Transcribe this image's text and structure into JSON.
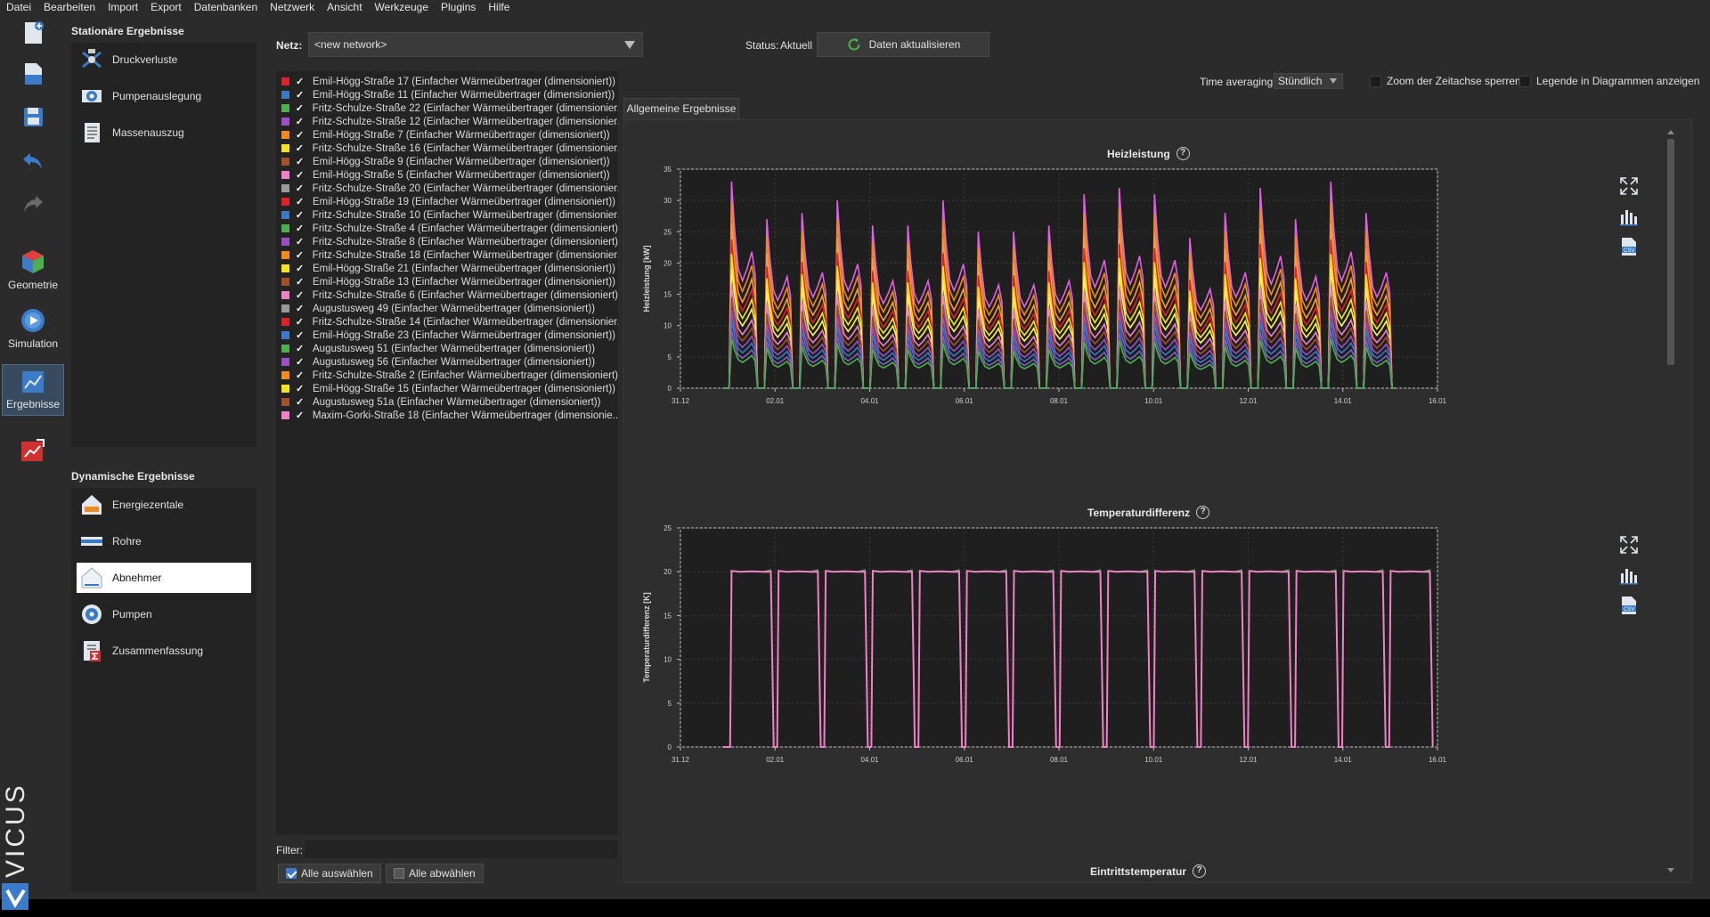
{
  "menu": [
    "Datei",
    "Bearbeiten",
    "Import",
    "Export",
    "Datenbanken",
    "Netzwerk",
    "Ansicht",
    "Werkzeuge",
    "Plugins",
    "Hilfe"
  ],
  "toolbar": {
    "geometry_label": "Geometrie",
    "simulation_label": "Simulation",
    "results_label": "Ergebnisse",
    "brand": "VICUS"
  },
  "stationary": {
    "title": "Stationäre Ergebnisse",
    "items": [
      "Druckverluste",
      "Pumpenauslegung",
      "Massenauszug"
    ]
  },
  "dynamic": {
    "title": "Dynamische Ergebnisse",
    "items": [
      "Energiezentale",
      "Rohre",
      "Abnehmer",
      "Pumpen",
      "Zusammenfassung"
    ],
    "selected": "Abnehmer"
  },
  "network": {
    "label": "Netz:",
    "value": "<new network>",
    "status_label": "Status:",
    "status_value": "Aktuell",
    "refresh_label": "Daten aktualisieren"
  },
  "consumers": [
    {
      "name": "Emil-Högg-Straße 17 (Einfacher Wärmeübertrager (dimensioniert))",
      "color": "#e0202a"
    },
    {
      "name": "Emil-Högg-Straße 11 (Einfacher Wärmeübertrager (dimensioniert))",
      "color": "#3c78c8"
    },
    {
      "name": "Fritz-Schulze-Straße 22 (Einfacher Wärmeübertrager (dimensionier...",
      "color": "#4caf50"
    },
    {
      "name": "Fritz-Schulze-Straße 12 (Einfacher Wärmeübertrager (dimensionier...",
      "color": "#9c4fc4"
    },
    {
      "name": "Emil-Högg-Straße 7 (Einfacher Wärmeübertrager (dimensioniert))",
      "color": "#f08a1c"
    },
    {
      "name": "Fritz-Schulze-Straße 16 (Einfacher Wärmeübertrager (dimensionier...",
      "color": "#f2e520"
    },
    {
      "name": "Emil-Högg-Straße 9 (Einfacher Wärmeübertrager (dimensioniert))",
      "color": "#a0522d"
    },
    {
      "name": "Emil-Högg-Straße 5 (Einfacher Wärmeübertrager (dimensioniert))",
      "color": "#f080c8"
    },
    {
      "name": "Fritz-Schulze-Straße 20 (Einfacher Wärmeübertrager (dimensionier...",
      "color": "#9a9a9a"
    },
    {
      "name": "Emil-Högg-Straße 19 (Einfacher Wärmeübertrager (dimensioniert))",
      "color": "#e0202a"
    },
    {
      "name": "Fritz-Schulze-Straße 10 (Einfacher Wärmeübertrager (dimensionier...",
      "color": "#3c78c8"
    },
    {
      "name": "Fritz-Schulze-Straße 4 (Einfacher Wärmeübertrager (dimensioniert))",
      "color": "#4caf50"
    },
    {
      "name": "Fritz-Schulze-Straße 8 (Einfacher Wärmeübertrager (dimensioniert))",
      "color": "#9c4fc4"
    },
    {
      "name": "Fritz-Schulze-Straße 18 (Einfacher Wärmeübertrager (dimensionier...",
      "color": "#f08a1c"
    },
    {
      "name": "Emil-Högg-Straße 21 (Einfacher Wärmeübertrager (dimensioniert))",
      "color": "#f2e520"
    },
    {
      "name": "Emil-Högg-Straße 13 (Einfacher Wärmeübertrager (dimensioniert))",
      "color": "#a0522d"
    },
    {
      "name": "Fritz-Schulze-Straße 6 (Einfacher Wärmeübertrager (dimensioniert))",
      "color": "#f080c8"
    },
    {
      "name": "Augustusweg 49 (Einfacher Wärmeübertrager (dimensioniert))",
      "color": "#9a9a9a"
    },
    {
      "name": "Fritz-Schulze-Straße 14 (Einfacher Wärmeübertrager (dimensionier...",
      "color": "#e0202a"
    },
    {
      "name": "Emil-Högg-Straße 23 (Einfacher Wärmeübertrager (dimensioniert))",
      "color": "#3c78c8"
    },
    {
      "name": "Augustusweg 51 (Einfacher Wärmeübertrager (dimensioniert))",
      "color": "#4caf50"
    },
    {
      "name": "Augustusweg 56 (Einfacher Wärmeübertrager (dimensioniert))",
      "color": "#9c4fc4"
    },
    {
      "name": "Fritz-Schulze-Straße 2 (Einfacher Wärmeübertrager (dimensioniert))",
      "color": "#f08a1c"
    },
    {
      "name": "Emil-Högg-Straße 15 (Einfacher Wärmeübertrager (dimensioniert))",
      "color": "#f2e520"
    },
    {
      "name": "Augustusweg 51a (Einfacher Wärmeübertrager (dimensioniert))",
      "color": "#a0522d"
    },
    {
      "name": "Maxim-Gorki-Straße 18 (Einfacher Wärmeübertrager (dimensionie...",
      "color": "#f080c8"
    }
  ],
  "filter": {
    "label": "Filter:",
    "value": ""
  },
  "select_all_label": "Alle auswählen",
  "deselect_all_label": "Alle abwählen",
  "options": {
    "time_averaging_label": "Time averaging",
    "time_averaging_value": "Stündlich",
    "zoom_lock_label": "Zoom der Zeitachse sperren",
    "legend_label": "Legende in Diagrammen anzeigen"
  },
  "tab_label": "Allgemeine Ergebnisse",
  "third_chart_title": "Eintrittstemperatur",
  "chart_data": [
    {
      "type": "line",
      "title": "Heizleistung",
      "ylabel": "Heizleistung [kW]",
      "ylim": [
        0,
        35
      ],
      "yticks": [
        "0",
        "5",
        "10",
        "15",
        "20",
        "25",
        "30",
        "35"
      ],
      "xticks": [
        "31.12",
        "02.01",
        "04.01",
        "06.01",
        "08.01",
        "10.01",
        "12.01",
        "14.01",
        "16.01"
      ],
      "grid": true,
      "day_peaks_kW": [
        33,
        27,
        28,
        30,
        26,
        26,
        30,
        25,
        25,
        26,
        31,
        32,
        31,
        24,
        28,
        32,
        27,
        33,
        28
      ],
      "series_scales": [
        1.0,
        0.9,
        0.8,
        0.72,
        0.65,
        0.58,
        0.5,
        0.44,
        0.38,
        0.33,
        0.28,
        0.24
      ],
      "series_colors": [
        "#e060e0",
        "#f08a1c",
        "#f0a040",
        "#e0202a",
        "#f2e520",
        "#fff060",
        "#f080c8",
        "#a0522d",
        "#9c4fc4",
        "#3c78c8",
        "#8060c0",
        "#4caf50"
      ]
    },
    {
      "type": "line",
      "title": "Temperaturdifferenz",
      "ylabel": "Temperaturdifferenz [K]",
      "ylim": [
        0,
        25
      ],
      "yticks": [
        "0",
        "5",
        "10",
        "15",
        "20",
        "25"
      ],
      "xticks": [
        "31.12",
        "02.01",
        "04.01",
        "06.01",
        "08.01",
        "10.01",
        "12.01",
        "14.01",
        "16.01"
      ],
      "grid": true,
      "plateau_K": 20,
      "series_colors": [
        "#4caf50",
        "#f080c8"
      ]
    }
  ]
}
